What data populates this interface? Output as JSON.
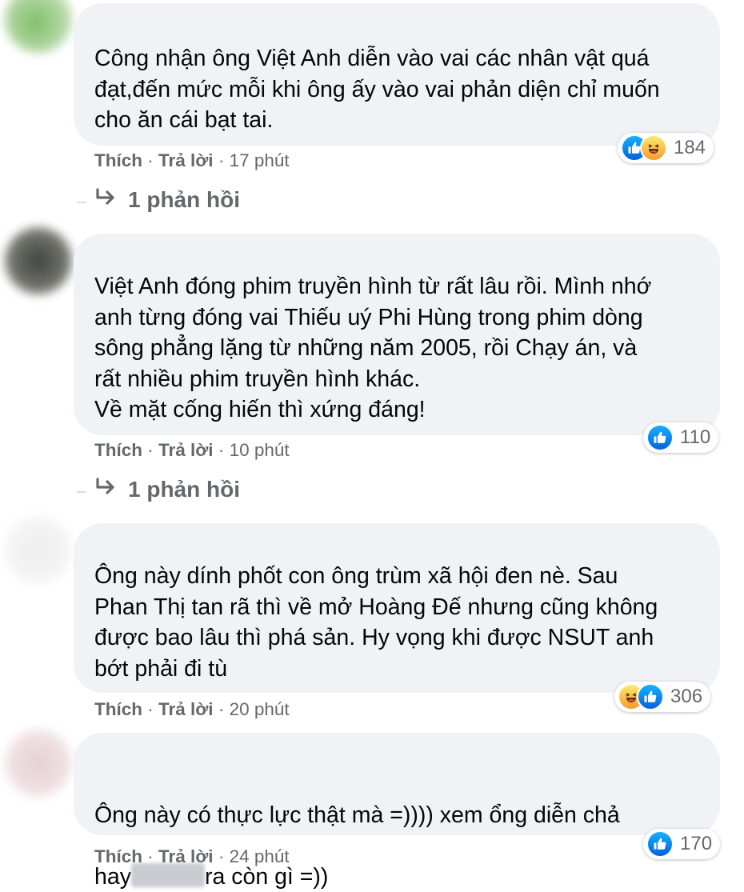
{
  "comments": [
    {
      "text": "Công nhận ông Việt Anh diễn vào vai các nhân vật quá\nđạt,đến mức mỗi khi ông ấy vào vai phản diện chỉ muốn\ncho ăn cái bạt tai.",
      "like_label": "Thích",
      "reply_label": "Trả lời",
      "time": "17 phút",
      "reaction_count": "184",
      "reactions": [
        "like-icon",
        "haha-icon"
      ],
      "replies_label": "1 phản hồi"
    },
    {
      "text": "Việt Anh đóng phim truyền hình từ rất lâu rồi. Mình nhớ\nanh từng đóng vai Thiếu uý Phi Hùng trong phim dòng\nsông phẳng lặng từ những năm 2005, rồi Chạy án, và\nrất nhiều phim truyền hình khác.\nVề mặt cống hiến thì xứng đáng!",
      "like_label": "Thích",
      "reply_label": "Trả lời",
      "time": "10 phút",
      "reaction_count": "110",
      "reactions": [
        "like-icon"
      ],
      "replies_label": "1 phản hồi"
    },
    {
      "text": "Ông này dính phốt con ông trùm xã hội đen nè. Sau\nPhan Thị tan rã thì về mở Hoàng Đế nhưng cũng không\nđược bao lâu thì phá sản. Hy vọng khi được NSUT anh\nbớt phải đi tù",
      "like_label": "Thích",
      "reply_label": "Trả lời",
      "time": "20 phút",
      "reaction_count": "306",
      "reactions": [
        "haha-icon",
        "like-icon"
      ]
    },
    {
      "text_line1": "Ông này có thực lực thật mà =)))) xem ổng diễn chả",
      "text_line2_start": "hay",
      "text_line2_end": "ra còn gì =))",
      "like_label": "Thích",
      "reply_label": "Trả lời",
      "time": "24 phút",
      "reaction_count": "170",
      "reactions": [
        "like-icon"
      ]
    }
  ],
  "separator": "·",
  "colors": {
    "bubble": "#f0f2f5",
    "meta": "#65676b",
    "like": "#0571ed",
    "haha": "#f7b125"
  }
}
